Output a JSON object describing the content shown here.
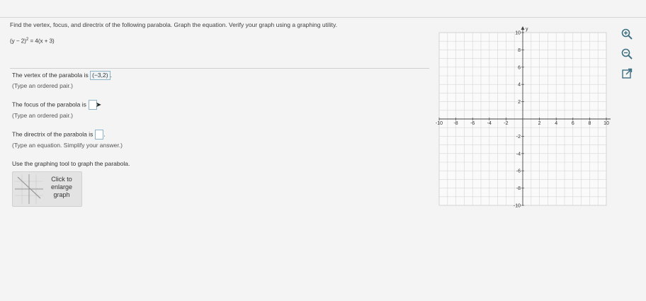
{
  "question": {
    "title": "Find the vertex, focus, and directrix of the following parabola. Graph the equation. Verify your graph using a graphing utility.",
    "equation_base": "(y − 2)",
    "equation_exp": "2",
    "equation_rest": " = 4(x + 3)"
  },
  "vertex": {
    "label": "The vertex of the parabola is",
    "value": "(−3,2)",
    "hint": "(Type an ordered pair.)"
  },
  "focus": {
    "label": "The focus of the parabola is",
    "value": "",
    "hint": "(Type an ordered pair.)"
  },
  "directrix": {
    "label": "The directrix of the parabola is",
    "value": "",
    "hint": "(Type an equation. Simplify your answer.)"
  },
  "instruction": "Use the graphing tool to graph the parabola.",
  "enlarge_button": {
    "label": "Click to\nenlarge\ngraph"
  },
  "graph": {
    "x_axis_label": "x",
    "y_axis_label": "y",
    "x_range": [
      -10,
      10
    ],
    "y_range": [
      -10,
      10
    ],
    "x_ticks": [
      "-10",
      "-8",
      "-6",
      "-4",
      "-2",
      "2",
      "4",
      "6",
      "8",
      "10"
    ],
    "y_ticks": [
      "10",
      "8",
      "6",
      "4",
      "2",
      "-2",
      "-4",
      "-6",
      "-8",
      "-10"
    ],
    "grid": true
  },
  "tools": [
    "zoom-in-icon",
    "zoom-out-icon",
    "open-new-window-icon"
  ],
  "colors": {
    "answer_border": "#8fb4c8",
    "grid_line": "#d6d6d6",
    "axis": "#444444"
  }
}
